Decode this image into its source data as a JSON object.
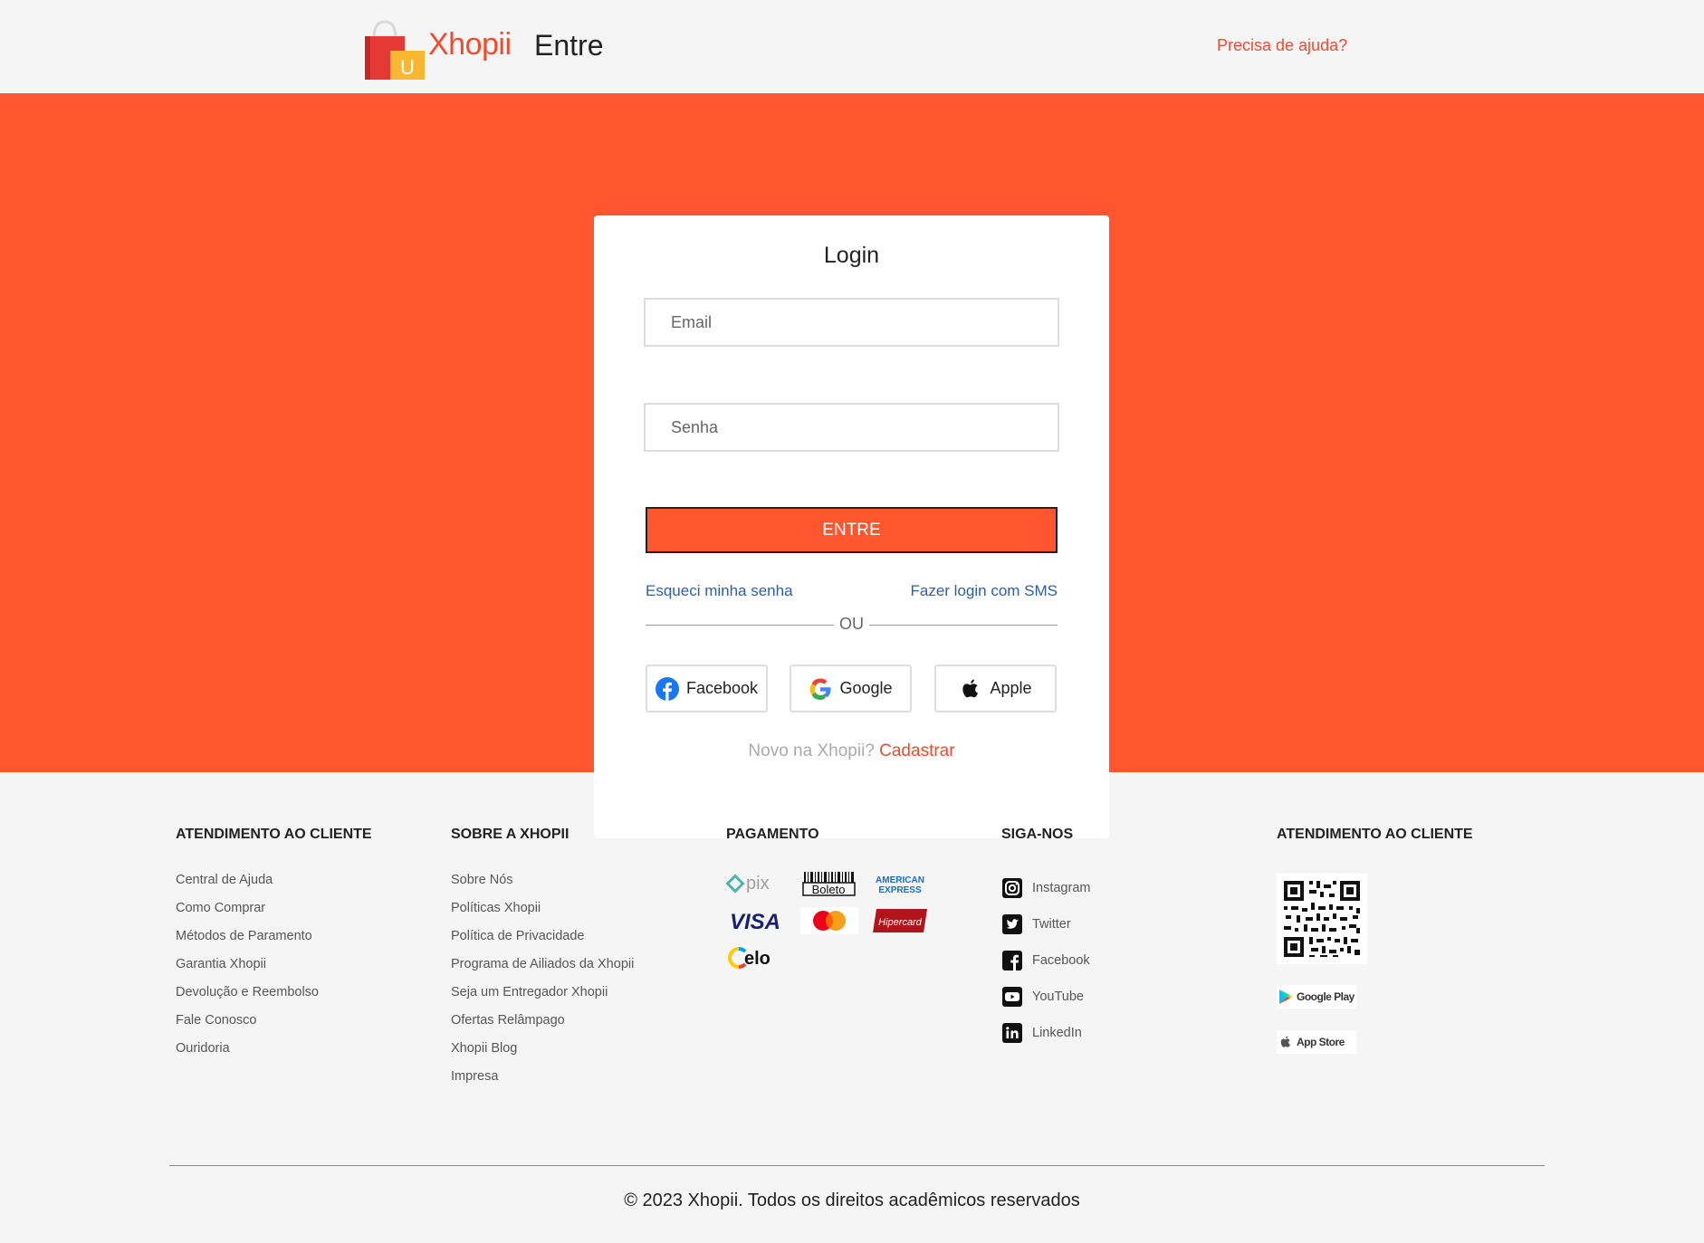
{
  "header": {
    "brand": "Xhopii",
    "bag_letter": "U",
    "title": "Entre",
    "help_link": "Precisa de ajuda?"
  },
  "login": {
    "title": "Login",
    "email_placeholder": "Email",
    "password_placeholder": "Senha",
    "submit_label": "ENTRE",
    "forgot_link": "Esqueci minha senha",
    "sms_link": "Fazer login com SMS",
    "divider_text": "OU",
    "social": {
      "facebook": "Facebook",
      "google": "Google",
      "apple": "Apple"
    },
    "signup_prompt": "Novo na Xhopii?",
    "signup_link": "Cadastrar"
  },
  "footer": {
    "col1": {
      "heading": "ATENDIMENTO AO CLIENTE",
      "links": [
        "Central de Ajuda",
        "Como Comprar",
        "Métodos de Paramento",
        "Garantia Xhopii",
        "Devolução e Reembolso",
        "Fale Conosco",
        "Ouridoria"
      ]
    },
    "col2": {
      "heading": "SOBRE A XHOPII",
      "links": [
        "Sobre Nós",
        "Políticas Xhopii",
        "Política de Privacidade",
        "Programa de Ailiados da Xhopii",
        "Seja um Entregador Xhopii",
        "Ofertas Relâmpago",
        "Xhopii Blog",
        "Impresa"
      ]
    },
    "col3": {
      "heading": "PAGAMENTO",
      "methods": {
        "pix": "pix",
        "boleto": "Boleto",
        "amex_1": "AMERICAN",
        "amex_2": "EXPRESS",
        "visa": "VISA",
        "hipercard": "Hipercard",
        "elo": "elo"
      }
    },
    "col4": {
      "heading": "SIGA-NOS",
      "links": [
        "Instagram",
        "Twitter",
        "Facebook",
        "YouTube",
        "LinkedIn"
      ]
    },
    "col5": {
      "heading": "ATENDIMENTO AO CLIENTE",
      "google_play": "Google Play",
      "app_store": "App Store"
    },
    "copyright": "© 2023 Xhopii. Todos os direitos acadêmicos reservados"
  },
  "colors": {
    "brand_orange": "#ee4d2d",
    "hero_orange": "#ff5630",
    "link_blue": "#2e5fa3"
  }
}
